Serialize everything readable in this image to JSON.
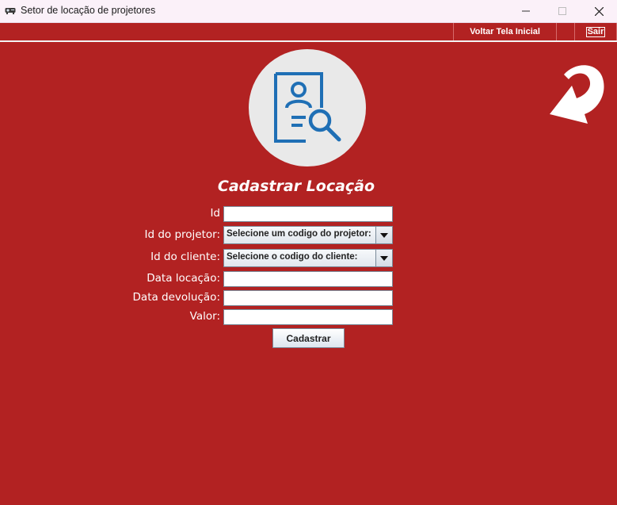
{
  "window": {
    "title": "Setor de locação de projetores",
    "minimize_icon": "minimize-icon",
    "maximize_icon": "maximize-icon",
    "close_icon": "close-icon"
  },
  "menubar": {
    "voltar_label": "Voltar Tela Inicial",
    "sair_label": "Sair"
  },
  "header": {
    "avatar_icon": "document-user-search-icon",
    "return_icon": "return-arrow-icon"
  },
  "form": {
    "title": "Cadastrar Locação",
    "fields": {
      "id": {
        "label": "Id",
        "value": ""
      },
      "projetor": {
        "label": "Id do projetor:",
        "selected": "Selecione um codigo do projetor:"
      },
      "cliente": {
        "label": "Id do cliente:",
        "selected": "Selecione o codigo do cliente:"
      },
      "data_locacao": {
        "label": "Data locação:",
        "value": ""
      },
      "data_devolucao": {
        "label": "Data devolução:",
        "value": ""
      },
      "valor": {
        "label": "Valor:",
        "value": ""
      }
    },
    "submit_label": "Cadastrar"
  },
  "colors": {
    "background": "#b22222",
    "titlebar": "#fbf1f9",
    "icon_blue": "#1f6fb5",
    "avatar_bg": "#e9e9e9"
  }
}
